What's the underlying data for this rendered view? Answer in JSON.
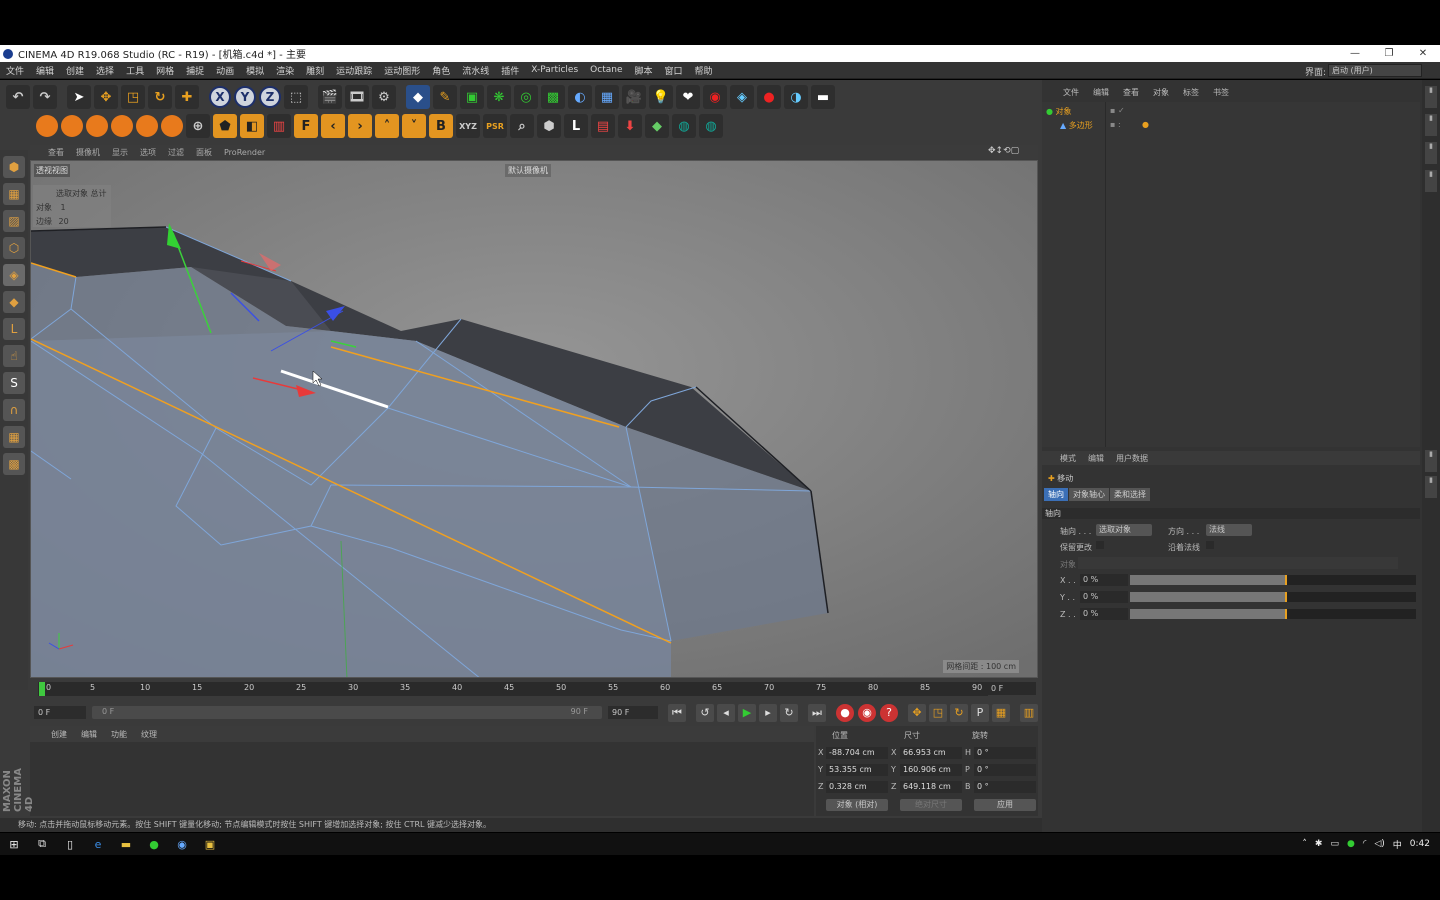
{
  "window": {
    "title": "CINEMA 4D R19.068 Studio (RC - R19) - [机箱.c4d *] - 主要",
    "controls": [
      "—",
      "❐",
      "✕"
    ]
  },
  "menu": {
    "items": [
      "文件",
      "编辑",
      "创建",
      "选择",
      "工具",
      "网格",
      "捕捉",
      "动画",
      "模拟",
      "渲染",
      "雕刻",
      "运动跟踪",
      "运动图形",
      "角色",
      "流水线",
      "插件",
      "X-Particles",
      "Octane",
      "脚本",
      "窗口",
      "帮助"
    ],
    "layout_label": "界面:",
    "layout_value": "启动 (用户)"
  },
  "viewport": {
    "menu": [
      "查看",
      "摄像机",
      "显示",
      "选项",
      "过滤",
      "面板",
      "ProRender"
    ],
    "name": "透视视图",
    "camera": "默认摄像机",
    "hud_title": "选取对象 总计",
    "hud_objects_label": "对象",
    "hud_objects_value": "1",
    "hud_edges_label": "边缘",
    "hud_edges_value": "20",
    "grid_spacing": "网格间距 : 100 cm"
  },
  "timeline": {
    "ticks": [
      "0",
      "5",
      "10",
      "15",
      "20",
      "25",
      "30",
      "35",
      "40",
      "45",
      "50",
      "55",
      "60",
      "65",
      "70",
      "75",
      "80",
      "85",
      "90"
    ],
    "current_frame": "0 F",
    "start": "0 F",
    "slider_left": "0 F",
    "slider_right": "90 F",
    "end": "90 F"
  },
  "material": {
    "menu": [
      "创建",
      "编辑",
      "功能",
      "纹理"
    ]
  },
  "coords": {
    "headers": [
      "位置",
      "尺寸",
      "旋转"
    ],
    "x_pos": "-88.704 cm",
    "y_pos": "53.355 cm",
    "z_pos": "0.328 cm",
    "x_size": "66.953 cm",
    "y_size": "160.906 cm",
    "z_size": "649.118 cm",
    "h": "0 °",
    "p": "0 °",
    "b": "0 °",
    "mode": "对象 (相对)",
    "size_mode": "绝对尺寸",
    "apply": "应用"
  },
  "status": "移动: 点击并拖动鼠标移动元素。按住 SHIFT 键量化移动; 节点编辑模式时按住 SHIFT 键增加选择对象; 按住 CTRL 键减少选择对象。",
  "objects": {
    "menu": [
      "文件",
      "编辑",
      "查看",
      "对象",
      "标签",
      "书签"
    ],
    "items": [
      {
        "name": "对象"
      },
      {
        "name": "多边形"
      }
    ]
  },
  "attributes": {
    "menu": [
      "模式",
      "编辑",
      "用户数据"
    ],
    "tool": "移动",
    "tabs": [
      "轴向",
      "对象轴心",
      "柔和选择"
    ],
    "section": "轴向",
    "axis_label": "轴向 . . .",
    "axis_value": "选取对象",
    "dir_label": "方向 . . .",
    "dir_value": "法线",
    "keep_label": "保留更改",
    "normal_label": "沿着法线",
    "object_label": "对象",
    "x_label": "X . .",
    "y_label": "Y . .",
    "z_label": "Z . .",
    "x_val": "0 %",
    "y_val": "0 %",
    "z_val": "0 %",
    "x_level": 0.55,
    "y_level": 0.55,
    "z_level": 0.55
  },
  "taskbar": {
    "time": "0:42",
    "ime": "中"
  }
}
